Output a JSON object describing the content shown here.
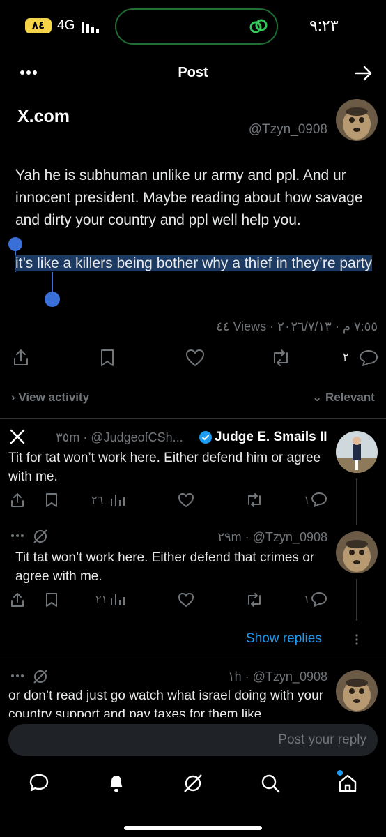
{
  "status_bar": {
    "battery": "٨٤",
    "network": "4G",
    "time": "٩:٢٣"
  },
  "header": {
    "title": "Post"
  },
  "post": {
    "watermark": "X.com",
    "handle": "@Tzyn_0908",
    "text": "Yah he is subhuman unlike ur army and ppl. And ur innocent president. Maybe reading about how savage and dirty your country and ppl well help you.",
    "selected_text": "it’s like a killers being bother why a thief in they’re party",
    "views": "٤٤ Views",
    "meta": "٧:٥٥ م · ٢٠٢٦/٧/١٣",
    "reply_count": "٢"
  },
  "activity": {
    "view_activity": "View activity",
    "sort": "Relevant"
  },
  "replies": [
    {
      "name": "Judge E. Smails II",
      "handle": "@JudgeofCSh...",
      "time": "٣٥m",
      "text": "Tit for tat won’t work here. Either defend him or agree with me.",
      "views": "٢٦",
      "replies": "١"
    },
    {
      "handle": "@Tzyn_0908",
      "time": "٢٩m",
      "text": "Tit tat won’t work here. Either defend that crimes or agree with me.",
      "views": "٢١",
      "replies": "١"
    },
    {
      "handle": "@Tzyn_0908",
      "time": "١h",
      "text": "or don’t read just go watch what israel doing with your country support and pay taxes for them like"
    }
  ],
  "show_replies": "Show replies",
  "composer": {
    "placeholder": "Post your reply"
  },
  "colors": {
    "accent": "#1d9bf0",
    "selection": "#1d3a63",
    "verified": "#1d9bf0"
  }
}
